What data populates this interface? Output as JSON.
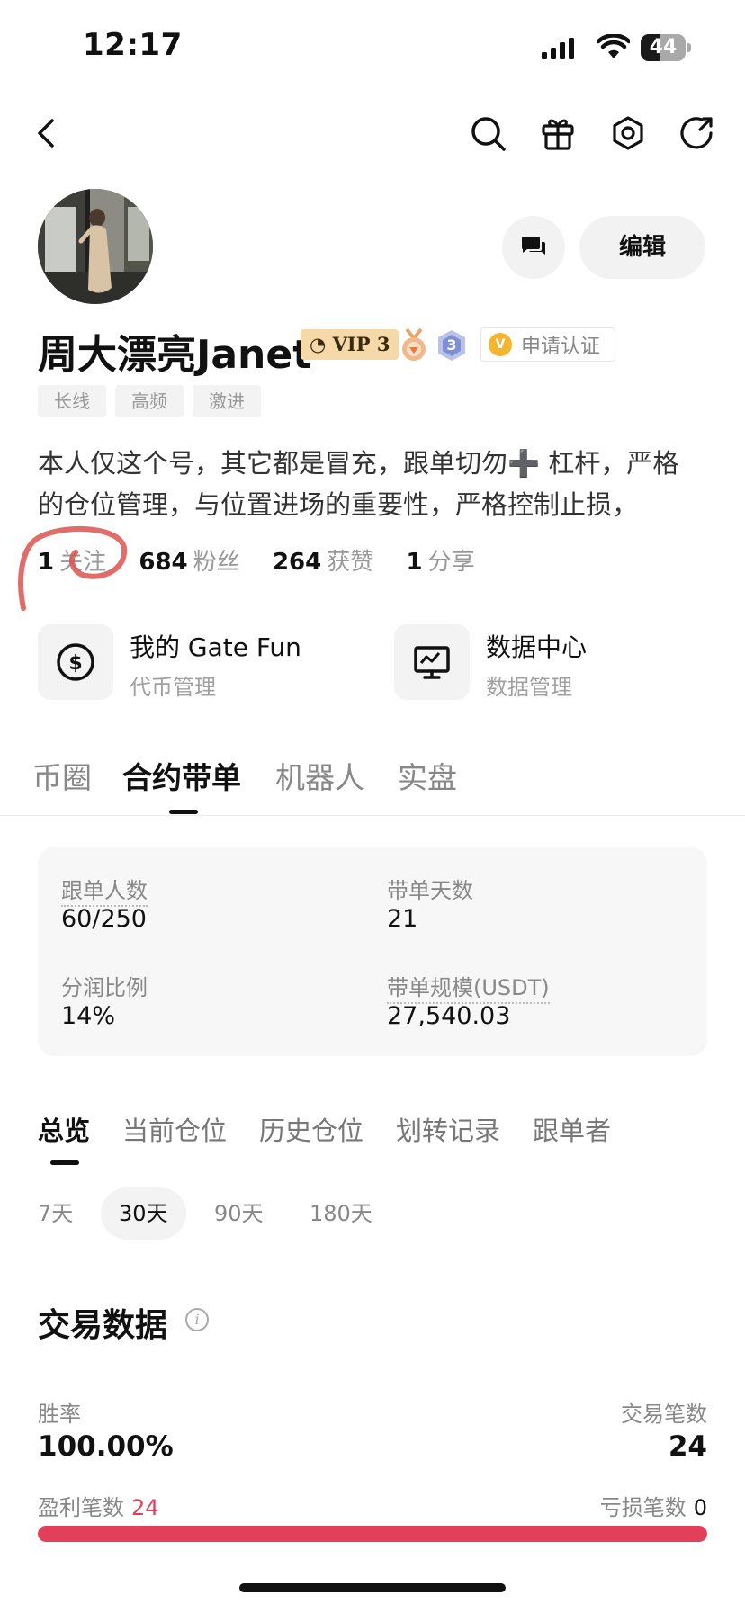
{
  "status_bar": {
    "time": "12:17",
    "battery": "44",
    "battery_level": 0.44
  },
  "profile": {
    "name": "周大漂亮Janet",
    "vip": "VIP 3",
    "level": "3",
    "verify_label": "申请认证",
    "verify_mark": "V",
    "edit_label": "编辑",
    "tags": [
      "长线",
      "高频",
      "激进"
    ],
    "bio": "本人仅这个号，其它都是冒充，跟单切勿➕ 杠杆，严格的仓位管理，与位置进场的重要性，严格控制止损，"
  },
  "stats": [
    {
      "value": "1",
      "label": "关注"
    },
    {
      "value": "684",
      "label": "粉丝"
    },
    {
      "value": "264",
      "label": "获赞"
    },
    {
      "value": "1",
      "label": "分享"
    }
  ],
  "features": [
    {
      "title": "我的 Gate Fun",
      "subtitle": "代币管理",
      "icon": "dollar-coin-icon"
    },
    {
      "title": "数据中心",
      "subtitle": "数据管理",
      "icon": "monitor-chart-icon"
    }
  ],
  "main_tabs": [
    "币圈",
    "合约带单",
    "机器人",
    "实盘"
  ],
  "main_tab_active": 1,
  "summary": {
    "followers_label": "跟单人数",
    "followers_value": "60/250",
    "days_label": "带单天数",
    "days_value": "21",
    "share_label": "分润比例",
    "share_value": "14%",
    "scale_label": "带单规模(USDT)",
    "scale_value": "27,540.03"
  },
  "sub_tabs": [
    "总览",
    "当前仓位",
    "历史仓位",
    "划转记录",
    "跟单者"
  ],
  "periods": [
    "7天",
    "30天",
    "90天",
    "180天"
  ],
  "period_active": 1,
  "trade_data": {
    "title": "交易数据",
    "info_mark": "i",
    "win_rate_label": "胜率",
    "win_rate_value": "100.00%",
    "trades_label": "交易笔数",
    "trades_value": "24",
    "profit_label": "盈利笔数",
    "profit_value": "24",
    "loss_label": "亏损笔数",
    "loss_value": "0",
    "profit_ratio": 1.0
  },
  "colors": {
    "accent_red": "#e2405a",
    "vip_gold": "#f6d9a8"
  }
}
